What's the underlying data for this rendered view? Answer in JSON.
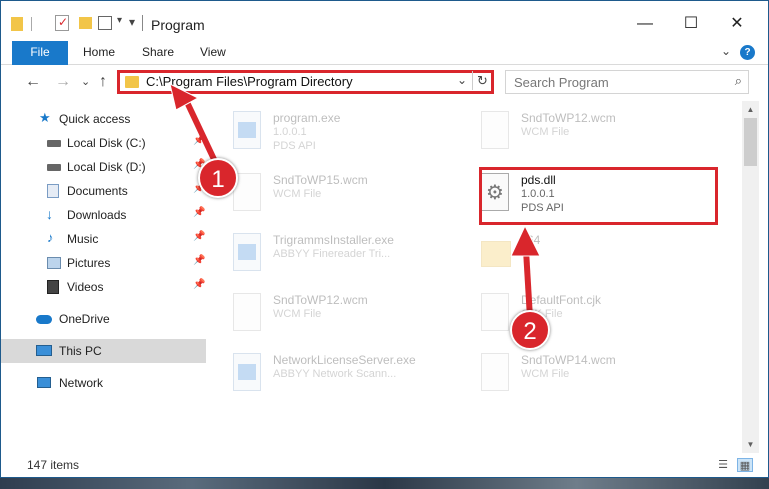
{
  "window": {
    "title": "Program",
    "minimize": "—",
    "maximize": "☐",
    "close": "✕"
  },
  "ribbon": {
    "tabs": [
      "File",
      "Home",
      "Share",
      "View"
    ],
    "collapse_icon": "⌄",
    "help_label": "?"
  },
  "nav": {
    "back": "←",
    "forward": "→",
    "recent": "⌄",
    "up": "↑",
    "address": "C:\\Program Files\\Program Directory",
    "address_dropdown": "⌄",
    "refresh": "↻",
    "search_placeholder": "Search Program",
    "search_icon": "⌕"
  },
  "sidebar": {
    "items": [
      {
        "label": "Quick access",
        "icon": "star-icon",
        "pinned": false
      },
      {
        "label": "Local Disk (C:)",
        "icon": "drive-icon",
        "pinned": true
      },
      {
        "label": "Local Disk (D:)",
        "icon": "drive-icon",
        "pinned": true
      },
      {
        "label": "Documents",
        "icon": "documents-icon",
        "pinned": true
      },
      {
        "label": "Downloads",
        "icon": "downloads-icon",
        "pinned": true
      },
      {
        "label": "Music",
        "icon": "music-icon",
        "pinned": true
      },
      {
        "label": "Pictures",
        "icon": "pictures-icon",
        "pinned": true
      },
      {
        "label": "Videos",
        "icon": "videos-icon",
        "pinned": true
      },
      {
        "label": "OneDrive",
        "icon": "cloud-icon",
        "pinned": false
      },
      {
        "label": "This PC",
        "icon": "computer-icon",
        "pinned": false,
        "selected": true
      },
      {
        "label": "Network",
        "icon": "network-icon",
        "pinned": false
      }
    ],
    "pin_glyph": "📌"
  },
  "files": [
    {
      "name": "program.exe",
      "line1": "1.0.0.1",
      "line2": "PDS API",
      "icon": "app-icon"
    },
    {
      "name": "SndToWP12.wcm",
      "line1": "WCM File",
      "line2": "",
      "icon": "file-icon"
    },
    {
      "name": "SndToWP15.wcm",
      "line1": "WCM File",
      "line2": "",
      "icon": "file-icon"
    },
    {
      "name": "pds.dll",
      "line1": "1.0.0.1",
      "line2": "PDS API",
      "icon": "dll-icon",
      "highlighted": true
    },
    {
      "name": "TrigrammsInstaller.exe",
      "line1": "ABBYY Finereader Tri...",
      "line2": "",
      "icon": "app-icon"
    },
    {
      "name": "x64",
      "line1": "",
      "line2": "",
      "icon": "folder-icon"
    },
    {
      "name": "SndToWP12.wcm",
      "line1": "WCM File",
      "line2": "",
      "icon": "file-icon"
    },
    {
      "name": "DefaultFont.cjk",
      "line1": "CJK File",
      "line2": "",
      "icon": "file-icon"
    },
    {
      "name": "NetworkLicenseServer.exe",
      "line1": "ABBYY Network Scann...",
      "line2": "",
      "icon": "app-icon"
    },
    {
      "name": "SndToWP14.wcm",
      "line1": "WCM File",
      "line2": "",
      "icon": "file-icon"
    }
  ],
  "status": {
    "item_count": "147 items"
  },
  "annotations": {
    "step1": "1",
    "step2": "2"
  },
  "colors": {
    "accent": "#1979ca",
    "highlight": "#d9262c"
  }
}
